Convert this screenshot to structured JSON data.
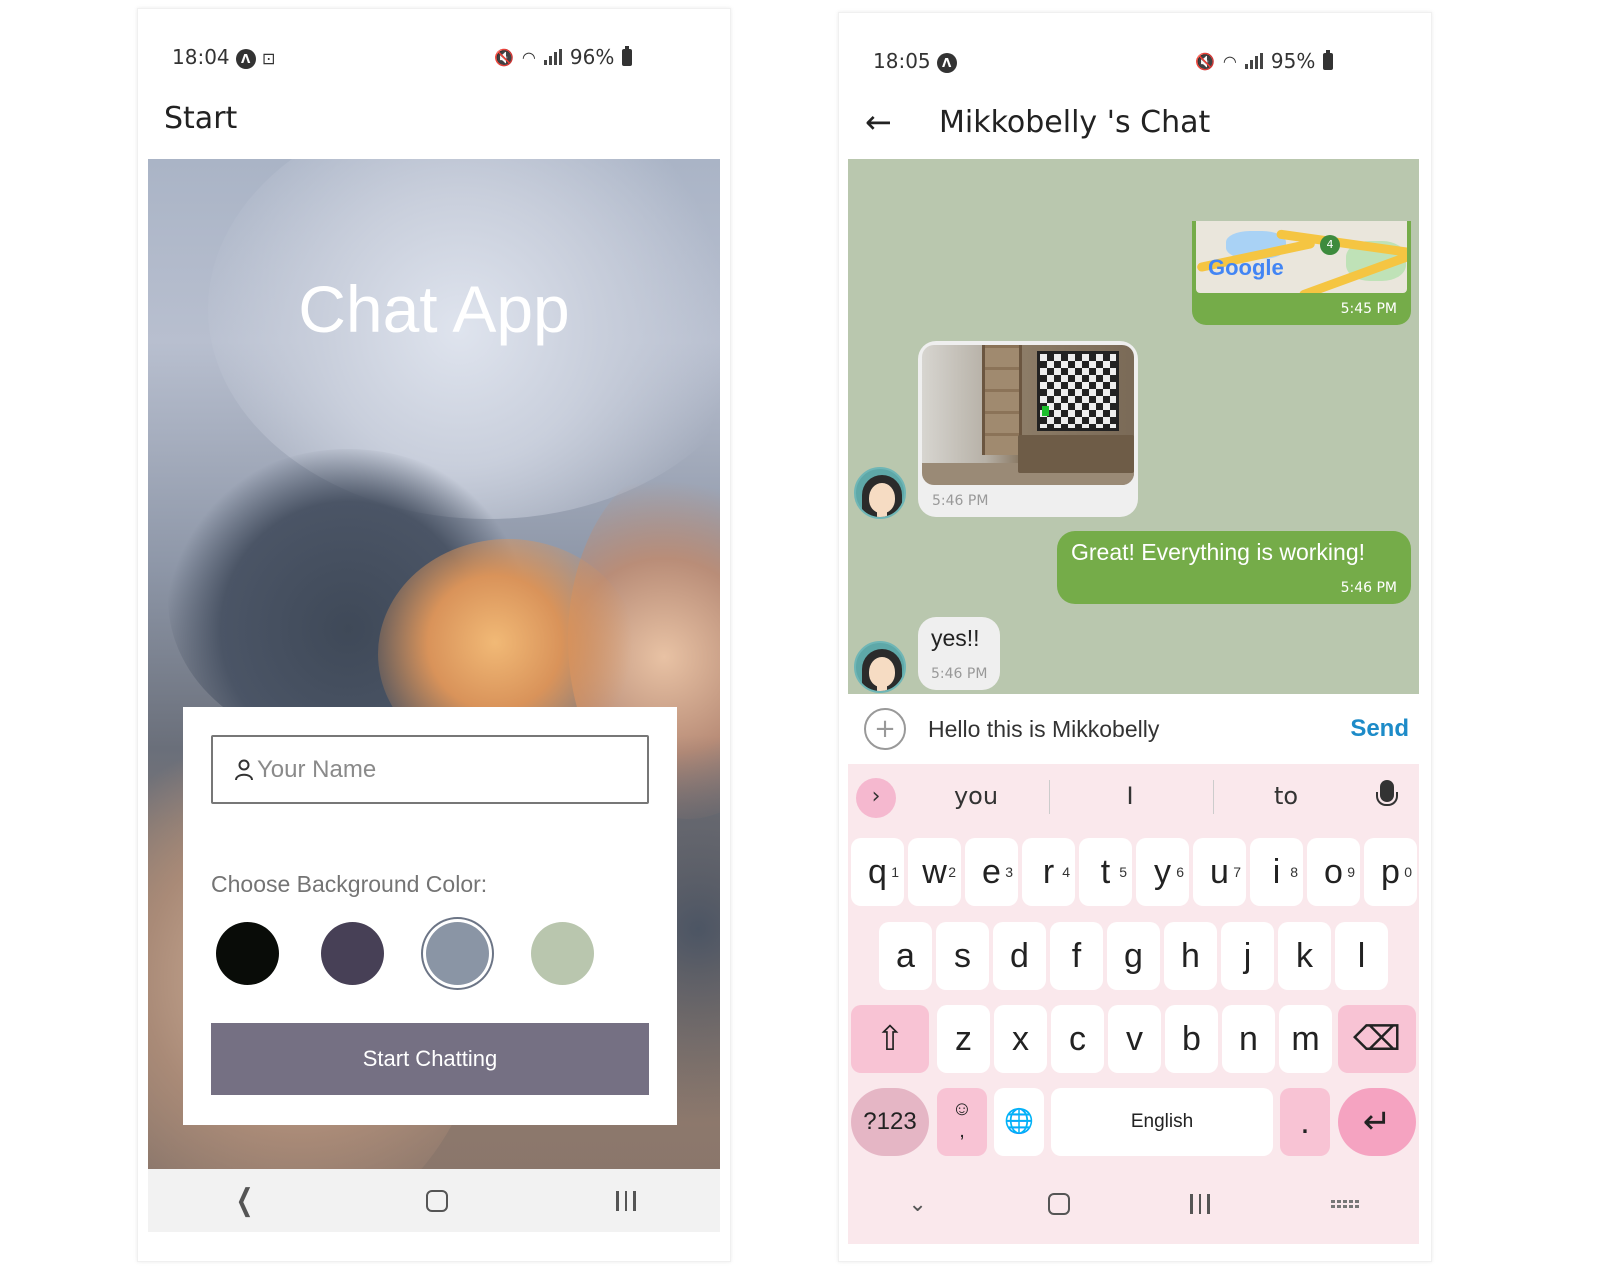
{
  "left": {
    "status": {
      "time": "18:04",
      "battery": "96%"
    },
    "appbar": {
      "title": "Start"
    },
    "hero": {
      "title": "Chat App"
    },
    "form": {
      "name_placeholder": "Your Name",
      "color_label": "Choose Background Color:",
      "colors": [
        "#090c08",
        "#474056",
        "#8a95a5",
        "#b9c6ae"
      ],
      "selected_color": "#8a95a5",
      "start_button": "Start Chatting",
      "start_button_color": "#757083"
    }
  },
  "right": {
    "status": {
      "time": "18:05",
      "battery": "95%"
    },
    "appbar": {
      "title": "Mikkobelly 's Chat"
    },
    "chat_bg": "#b9c7ae",
    "messages": [
      {
        "side": "out",
        "kind": "map",
        "map_label": "Google",
        "map_marker": "4",
        "time": "5:45 PM"
      },
      {
        "side": "in",
        "kind": "image",
        "time": "5:46 PM"
      },
      {
        "side": "out",
        "kind": "text",
        "text": "Great! Everything is working!",
        "time": "5:46 PM"
      },
      {
        "side": "in",
        "kind": "text",
        "text": "yes!!",
        "time": "5:46 PM"
      }
    ],
    "compose": {
      "value": "Hello this is Mikkobelly",
      "send": "Send",
      "plus": "+"
    },
    "keyboard": {
      "suggestions": [
        "you",
        "I",
        "to"
      ],
      "row1": [
        "q",
        "w",
        "e",
        "r",
        "t",
        "y",
        "u",
        "i",
        "o",
        "p"
      ],
      "row1_nums": [
        "1",
        "2",
        "3",
        "4",
        "5",
        "6",
        "7",
        "8",
        "9",
        "0"
      ],
      "row2": [
        "a",
        "s",
        "d",
        "f",
        "g",
        "h",
        "j",
        "k",
        "l"
      ],
      "row3": [
        "z",
        "x",
        "c",
        "v",
        "b",
        "n",
        "m"
      ],
      "symbols": "?123",
      "emoji_comma": ",",
      "space": "English",
      "period": "."
    }
  }
}
